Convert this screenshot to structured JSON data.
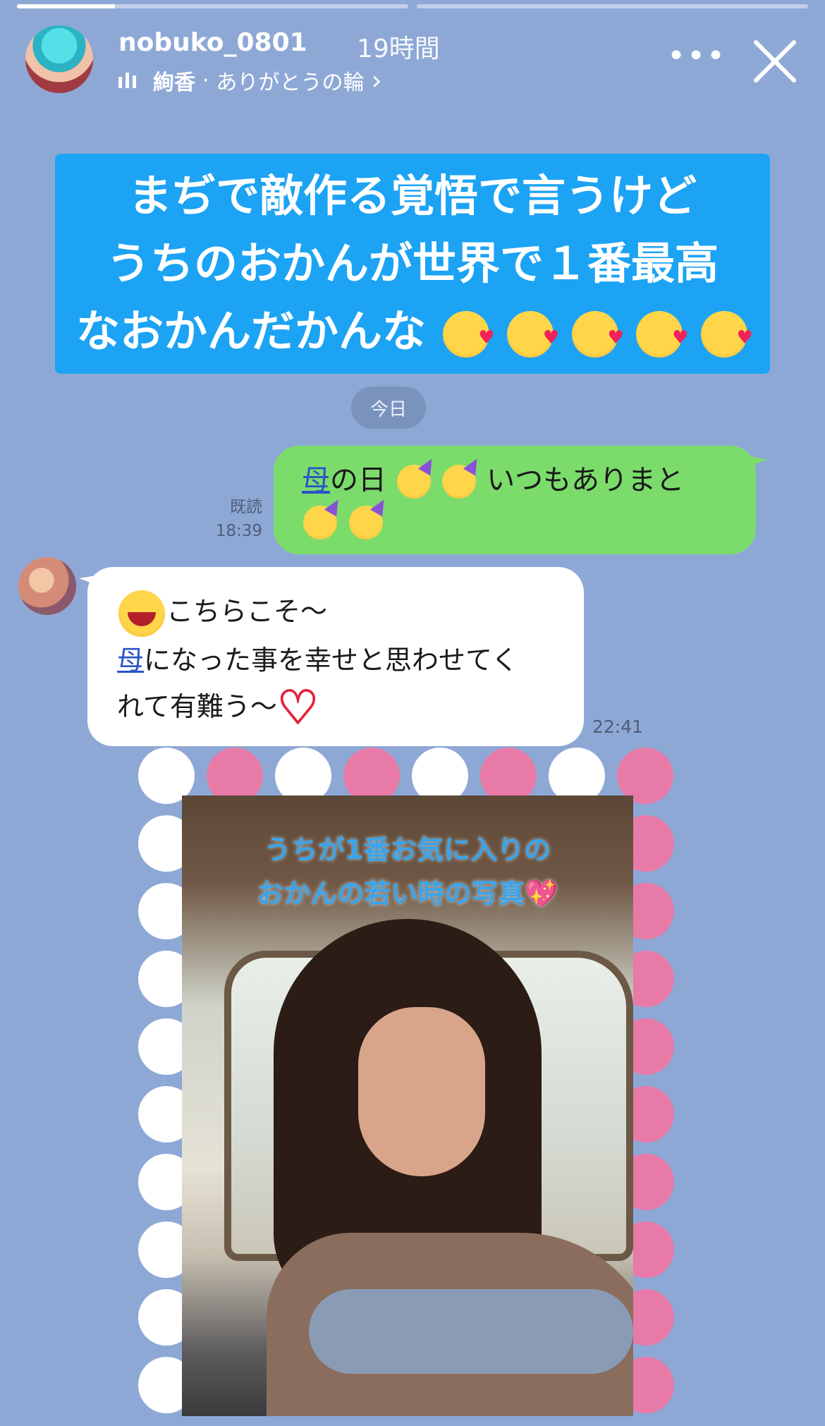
{
  "story": {
    "username": "nobuko_0801",
    "time": "19時間",
    "music_artist": "絢香",
    "music_separator": "·",
    "music_title": "ありがとうの輪",
    "music_chevron": "›",
    "more_label": "•••",
    "progress": [
      0.25,
      0
    ]
  },
  "banner": {
    "lines": [
      "まぢで敵作る覚悟で言うけど",
      "うちのおかんが世界で１番最高",
      "なおかんだかんな"
    ],
    "emoji_count": 5
  },
  "chat": {
    "date_label": "今日",
    "sent": {
      "read_label": "既読",
      "time": "18:39",
      "text_underlined": "母",
      "text_a": "の日",
      "text_b": "いつもありまと"
    },
    "received": {
      "line1": "こちらこそ〜",
      "line2_underlined": "母",
      "line2": "になった事を幸せと思わせてく",
      "line3": "れて有難う〜",
      "time": "22:41"
    }
  },
  "photo": {
    "caption_line1": "うちが1番お気に入りの",
    "caption_line2": "おかんの若い時の写真",
    "caption_emoji": "💖"
  },
  "colors": {
    "background": "#8ea8d6",
    "banner": "#1ca3f4",
    "sent_bubble": "#7bdc6b",
    "received_bubble": "#ffffff",
    "frame_pink": "#e87aa7",
    "caption": "#3aa4ea"
  }
}
